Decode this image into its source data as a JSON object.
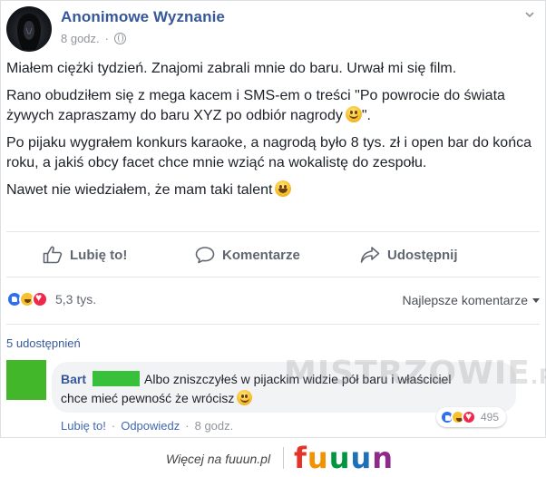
{
  "post": {
    "page_name": "Anonimowe Wyznanie",
    "time": "8 godz.",
    "dot": "·",
    "paragraphs": [
      "Miałem ciężki tydzień. Znajomi zabrali mnie do baru. Urwał mi się film.",
      "Rano obudziłem się z mega kacem i SMS-em o treści \"Po powrocie do świata żywych zapraszamy do baru XYZ po odbiór nagrody",
      "Po pijaku wygrałem konkurs karaoke, a nagrodą było 8 tys. zł i open bar do końca roku, a jakiś obcy facet chce mnie wziąć na wokalistę do zespołu.",
      "Nawet nie wiedziałem, że mam taki talent"
    ],
    "p2_tail": "\"."
  },
  "actions": {
    "like": "Lubię to!",
    "comment": "Komentarze",
    "share": "Udostępnij"
  },
  "reactions": {
    "count": "5,3 tys.",
    "sort_label": "Najlepsze komentarze",
    "shares": "5 udostępnień"
  },
  "comment": {
    "author": "Bart",
    "line1": "Albo zniszczyłeś w pijackim widzie pół baru i właściciel",
    "line2": "chce mieć pewność że wrócisz",
    "like_link": "Lubię to!",
    "reply_link": "Odpowiedz",
    "time": "8 godz.",
    "dot": "·",
    "reaction_count": "495"
  },
  "watermark": {
    "text": "MISTRZOWIE",
    "suffix": ".PL"
  },
  "footer": {
    "more": "Więcej na fuuun.pl",
    "brand": [
      "f",
      "u",
      "u",
      "u",
      "n"
    ],
    "brand_colors": [
      "#e6332a",
      "#f39200",
      "#009640",
      "#1d71b8",
      "#8e2a8a"
    ]
  },
  "icons": [
    "globe-icon",
    "chevron-down-icon",
    "like-icon",
    "comment-icon",
    "share-icon",
    "smile-emoji-icon",
    "laugh-emoji-icon",
    "wink-emoji-icon",
    "like-reaction-icon",
    "haha-reaction-icon",
    "love-reaction-icon",
    "sort-caret-icon"
  ]
}
